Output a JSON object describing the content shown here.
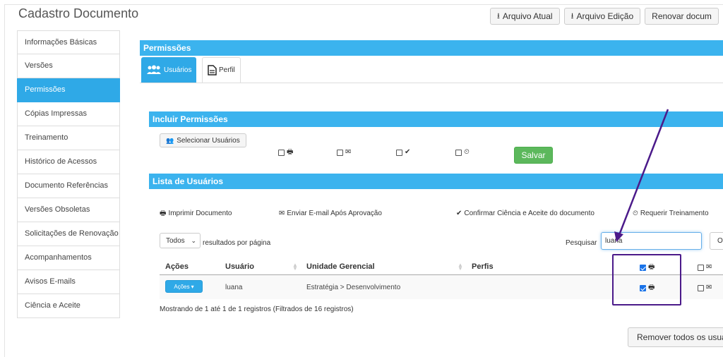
{
  "page": {
    "title": "Cadastro Documento"
  },
  "top_buttons": [
    {
      "label": "Arquivo Atual",
      "icon": "download-icon"
    },
    {
      "label": "Arquivo Edição",
      "icon": "download-icon"
    },
    {
      "label": "Renovar docum"
    }
  ],
  "sidebar": {
    "items": [
      {
        "label": "Informações Básicas"
      },
      {
        "label": "Versões"
      },
      {
        "label": "Permissões",
        "active": true
      },
      {
        "label": "Cópias Impressas"
      },
      {
        "label": "Treinamento"
      },
      {
        "label": "Histórico de Acessos"
      },
      {
        "label": "Documento Referências"
      },
      {
        "label": "Versões Obsoletas"
      },
      {
        "label": "Solicitações de Renovação"
      },
      {
        "label": "Acompanhamentos"
      },
      {
        "label": "Avisos E-mails"
      },
      {
        "label": "Ciência e Aceite"
      }
    ]
  },
  "permissions": {
    "title": "Permissões",
    "tabs": [
      {
        "label": "Usuários",
        "icon": "users-icon",
        "active": true
      },
      {
        "label": "Perfil",
        "icon": "document-icon"
      }
    ]
  },
  "include": {
    "title": "Incluir Permissões",
    "select_users_label": "Selecionar Usuários",
    "save_label": "Salvar"
  },
  "list": {
    "title": "Lista de Usuários",
    "legend": [
      {
        "icon": "print-icon",
        "label": "Imprimir Documento"
      },
      {
        "icon": "envelope-icon",
        "label": "Enviar E-mail Após Aprovação"
      },
      {
        "icon": "check-icon",
        "label": "Confirmar Ciência e Aceite do documento"
      },
      {
        "icon": "clock-icon",
        "label": "Requerir Treinamento"
      }
    ],
    "page_size": "Todos",
    "per_page_label": "resultados por página",
    "search_label": "Pesquisar",
    "search_value": "luana",
    "extra_button": "Or",
    "columns": [
      "Ações",
      "Usuário",
      "Unidade Gerencial",
      "Perfis"
    ],
    "rows": [
      {
        "action": "Ações",
        "user": "luana",
        "unit": "Estratégia > Desenvolvimento",
        "profiles": ""
      }
    ],
    "showing": "Mostrando de 1 até 1 de 1 registros (Filtrados de 16 registros)",
    "remove_all_label": "Remover todos os usuá"
  },
  "colors": {
    "accent": "#2fa9e7",
    "success": "#5cb85c",
    "annotation": "#4b1a8a"
  }
}
